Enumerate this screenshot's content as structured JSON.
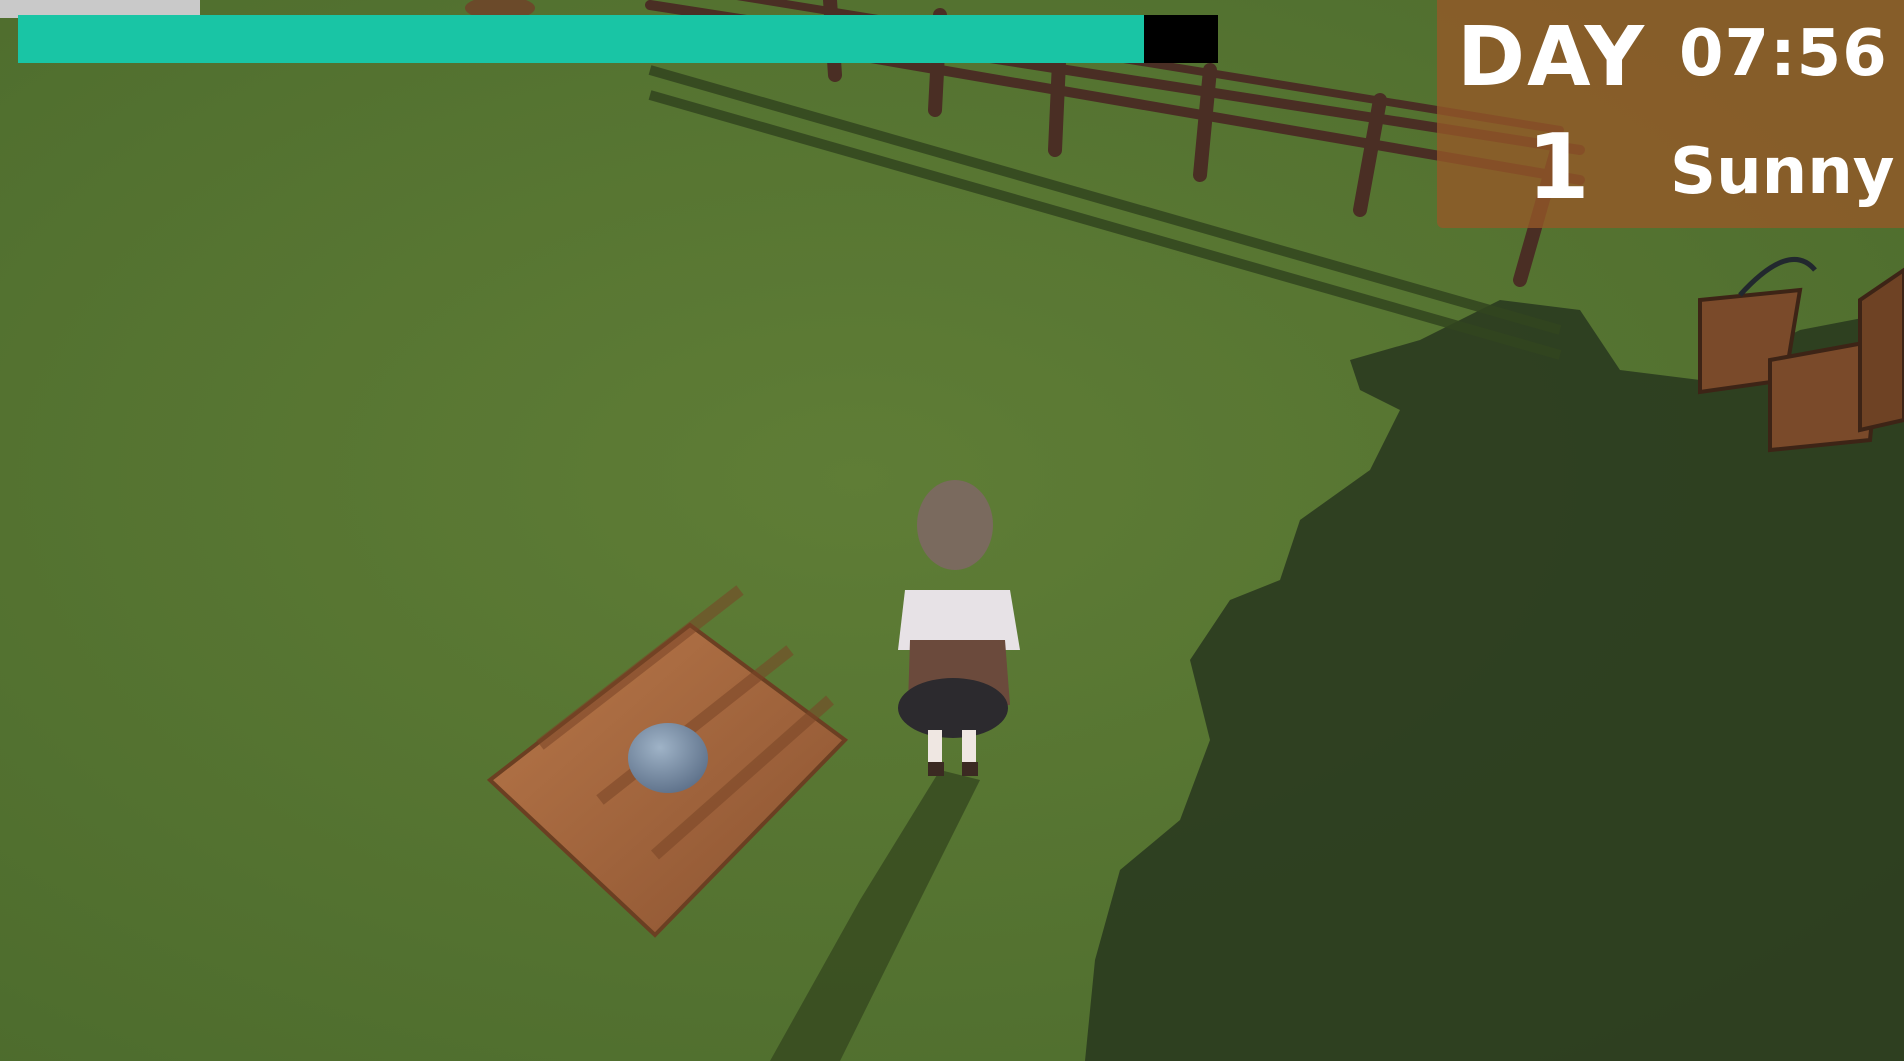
{
  "hud": {
    "stamina": {
      "fraction": 0.938,
      "fill_color": "#19c5a5",
      "empty_color": "#000000"
    },
    "day_label": "DAY",
    "day_number": "1",
    "time": "07:56",
    "weather": "Sunny"
  },
  "scene": {
    "ground_color": "#5a7634",
    "shadow_color": "#2a3a1e",
    "objects": [
      "wooden-fence",
      "water-buckets",
      "soil-plot",
      "seed",
      "farmer-girl"
    ]
  }
}
